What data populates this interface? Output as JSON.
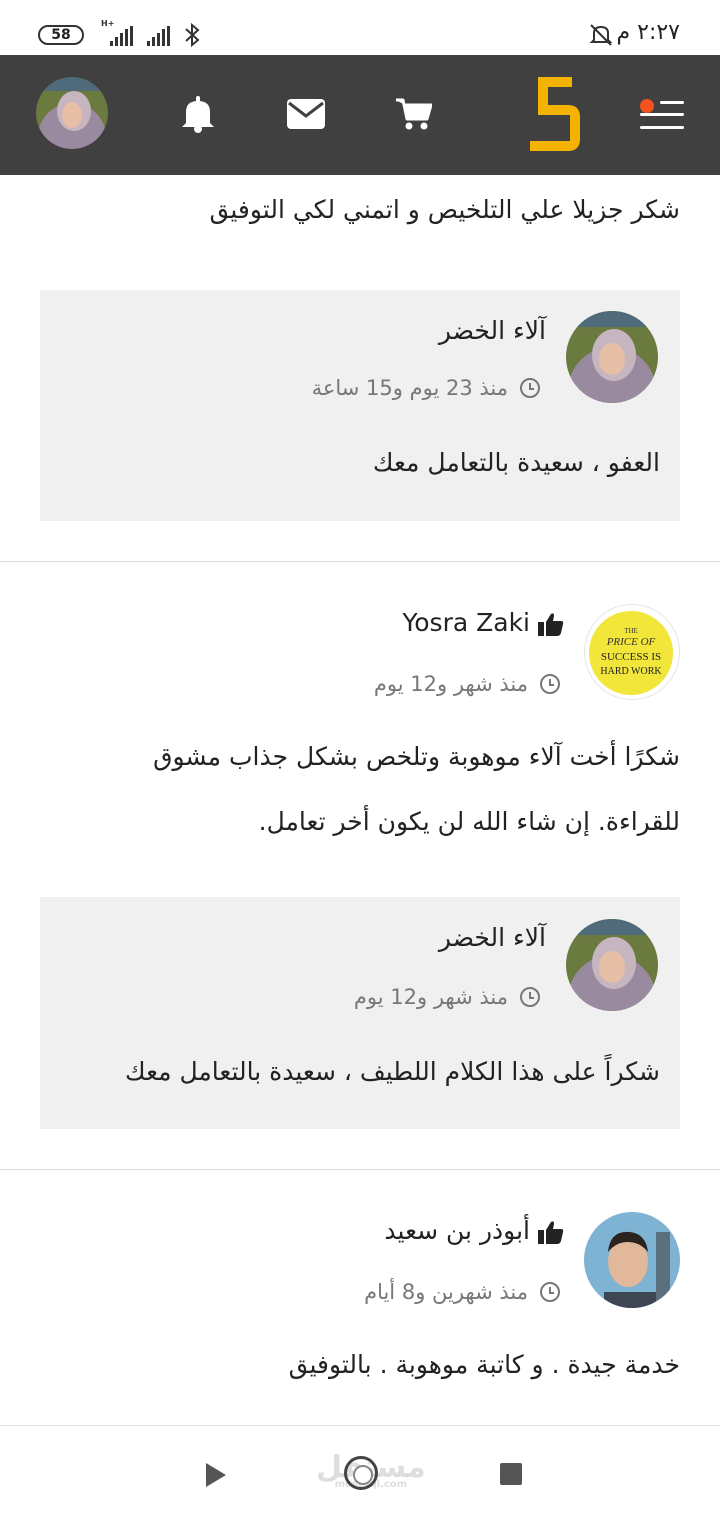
{
  "status_bar": {
    "battery": "58",
    "network_type": "H+",
    "time": "٢:٢٧ م"
  },
  "header": {
    "logo_text": "5",
    "icons": [
      "menu-icon",
      "cart-icon",
      "mail-icon",
      "bell-icon",
      "avatar"
    ],
    "accent_color": "#f5b301",
    "menu_dot_color": "#f4511e"
  },
  "comments": {
    "top_text": "شكر جزيلا علي التلخيص و اتمني لكي التوفيق",
    "reply1": {
      "author": "آلاء الخضر",
      "time": "منذ 23 يوم و15 ساعة",
      "text": "العفو ، سعيدة بالتعامل معك"
    },
    "comment2": {
      "author": "Yosra Zaki",
      "time": "منذ شهر و12 يوم",
      "text_line1": "شكرًا أخت آلاء موهوبة وتلخص بشكل جذاب مشوق",
      "text_line2": "للقراءة. إن شاء الله لن يكون أخر تعامل.",
      "avatar_text_1": "THE",
      "avatar_text_2": "PRICE OF",
      "avatar_text_3": "SUCCESS IS",
      "avatar_text_4": "HARD WORK"
    },
    "reply2": {
      "author": "آلاء الخضر",
      "time": "منذ شهر و12 يوم",
      "text": "شكراً على هذا الكلام اللطيف ، سعيدة بالتعامل معك"
    },
    "comment3": {
      "author": "أبوذر بن سعيد",
      "time": "منذ شهرين و8 أيام",
      "text": "خدمة جيدة . و كاتبة موهوبة . بالتوفيق"
    }
  },
  "nav_bar": {
    "watermark": "مستقل",
    "watermark_sub": "mostaql.com"
  }
}
